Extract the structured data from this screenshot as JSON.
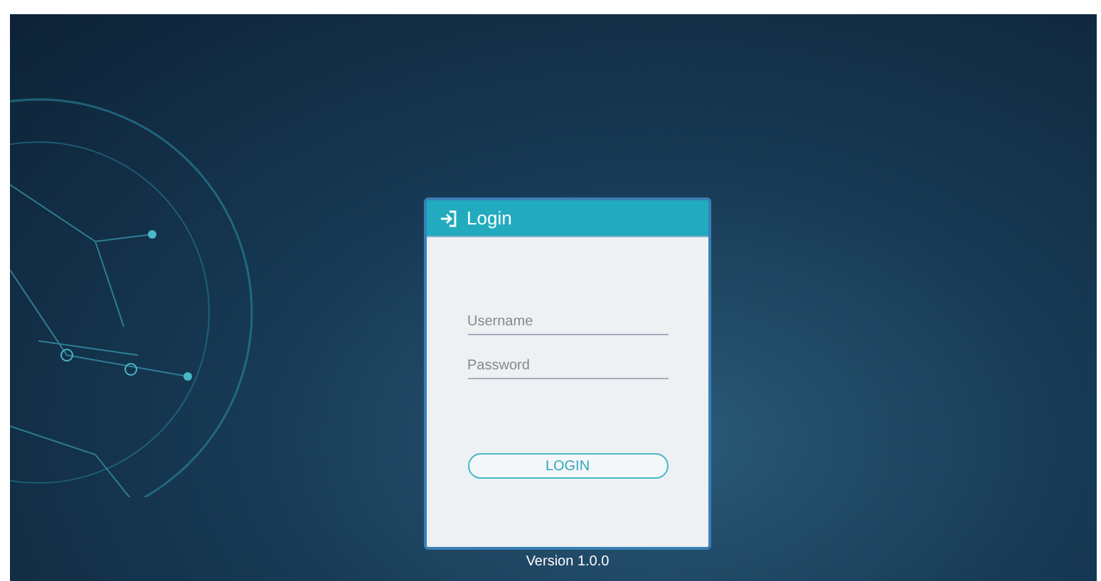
{
  "login_card": {
    "title": "Login",
    "username": {
      "placeholder": "Username"
    },
    "password": {
      "placeholder": "Password"
    },
    "button": "LOGIN"
  },
  "version": "Version 1.0.0"
}
